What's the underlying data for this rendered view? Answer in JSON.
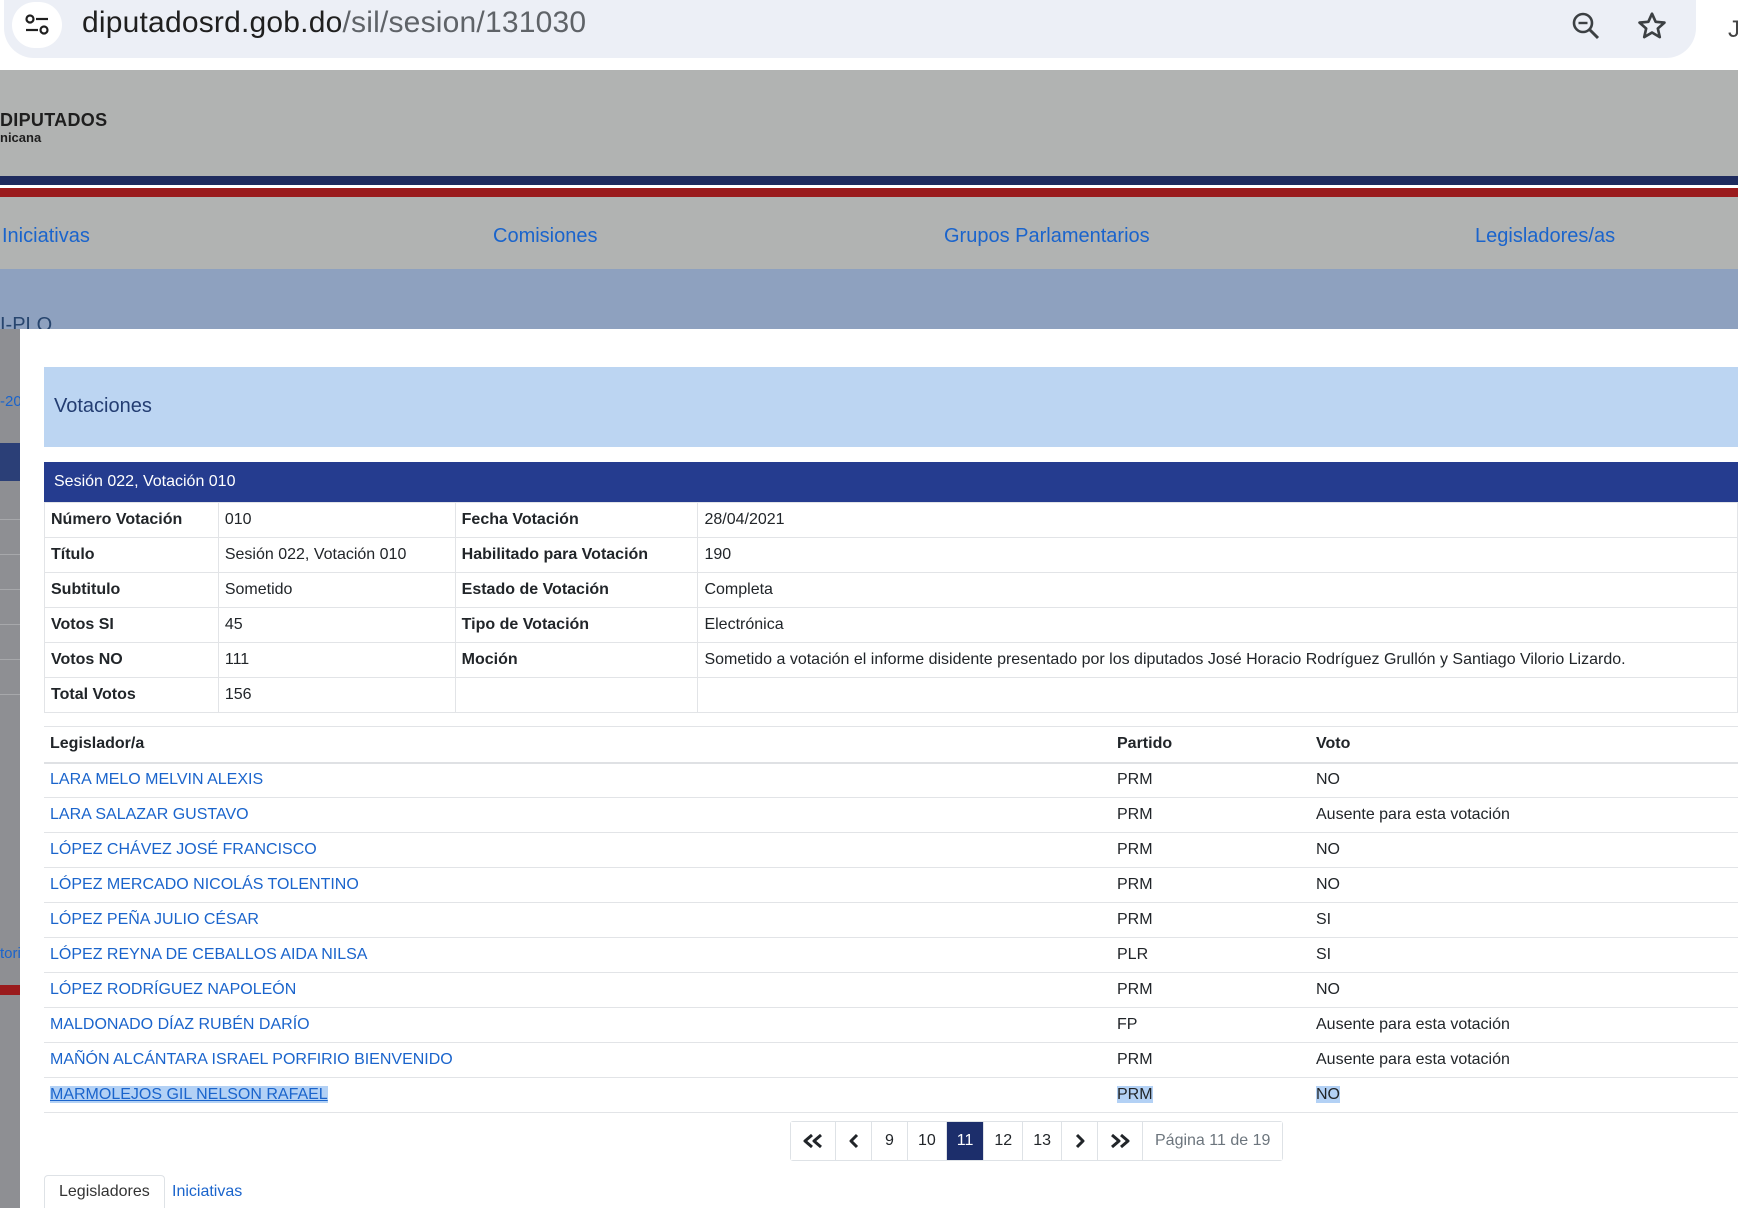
{
  "browser": {
    "url_host": "diputadosrd.gob.do",
    "url_path": "/sil/sesion/131030",
    "icons": [
      "site-settings-icon",
      "zoom-icon",
      "bookmark-star-icon"
    ]
  },
  "header": {
    "logo_main": "DIPUTADOS",
    "logo_sub": "nicana"
  },
  "nav": {
    "items": [
      "Iniciativas",
      "Comisiones",
      "Grupos Parlamentarios",
      "Legisladores/as"
    ]
  },
  "background": {
    "band_text": "I-PLO",
    "fragment_1": "-20",
    "fragment_2": "tori"
  },
  "modal": {
    "title": "Votaciones",
    "vote_header": "Sesión 022, Votación 010",
    "details": [
      {
        "label": "Número Votación",
        "value": "010",
        "label2": "Fecha Votación",
        "value2": "28/04/2021"
      },
      {
        "label": "Título",
        "value": "Sesión 022, Votación 010",
        "label2": "Habilitado para Votación",
        "value2": "190"
      },
      {
        "label": "Subtitulo",
        "value": "Sometido",
        "label2": "Estado de Votación",
        "value2": "Completa"
      },
      {
        "label": "Votos SI",
        "value": "45",
        "label2": "Tipo de Votación",
        "value2": "Electrónica"
      },
      {
        "label": "Votos NO",
        "value": "111",
        "label2": "Moción",
        "value2": "Sometido a votación el informe disidente presentado por los diputados José Horacio Rodríguez Grullón y Santiago Vilorio Lizardo."
      },
      {
        "label": "Total Votos",
        "value": "156",
        "label2": "",
        "value2": ""
      }
    ],
    "columns": [
      "Legislador/a",
      "Partido",
      "Voto"
    ],
    "rows": [
      {
        "name": "LARA MELO MELVIN ALEXIS",
        "party": "PRM",
        "vote": "NO"
      },
      {
        "name": "LARA SALAZAR GUSTAVO",
        "party": "PRM",
        "vote": "Ausente para esta votación"
      },
      {
        "name": "LÓPEZ CHÁVEZ JOSÉ FRANCISCO",
        "party": "PRM",
        "vote": "NO"
      },
      {
        "name": "LÓPEZ MERCADO NICOLÁS TOLENTINO",
        "party": "PRM",
        "vote": "NO"
      },
      {
        "name": "LÓPEZ PEÑA JULIO CÉSAR",
        "party": "PRM",
        "vote": "SI"
      },
      {
        "name": "LÓPEZ REYNA DE CEBALLOS AIDA NILSA",
        "party": "PLR",
        "vote": "SI"
      },
      {
        "name": "LÓPEZ RODRÍGUEZ NAPOLEÓN",
        "party": "PRM",
        "vote": "NO"
      },
      {
        "name": "MALDONADO DÍAZ RUBÉN DARÍO",
        "party": "FP",
        "vote": "Ausente para esta votación"
      },
      {
        "name": "MAÑÓN ALCÁNTARA ISRAEL PORFIRIO BIENVENIDO",
        "party": "PRM",
        "vote": "Ausente para esta votación"
      },
      {
        "name": "MARMOLEJOS GIL NELSON RAFAEL",
        "party": "PRM",
        "vote": "NO"
      }
    ],
    "pagination": {
      "pages": [
        "9",
        "10",
        "11",
        "12",
        "13"
      ],
      "current": "11",
      "info": "Página 11 de 19",
      "icons": [
        "first-page-icon",
        "prev-page-icon",
        "next-page-icon",
        "last-page-icon"
      ]
    },
    "tabs": [
      "Legisladores",
      "Iniciativas"
    ]
  },
  "colors": {
    "link": "#1a64cc",
    "header_gray": "#b1b3b2",
    "vote_header_navy": "#253c8f",
    "modal_header_light": "#bcd5f2",
    "active_page": "#1c2e6b",
    "selection": "#b3d1f5"
  }
}
